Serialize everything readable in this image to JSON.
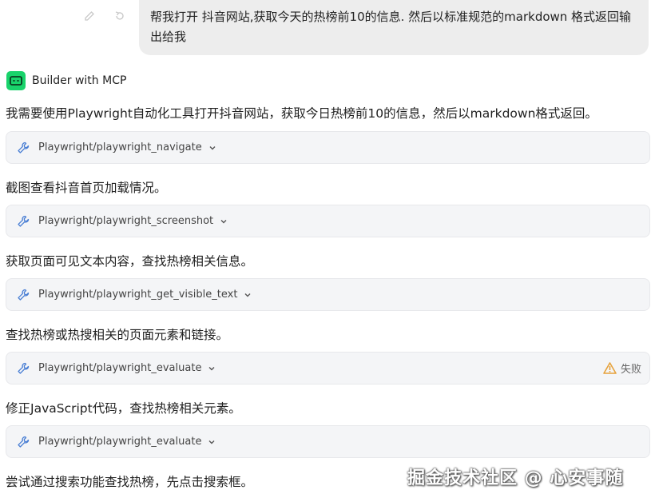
{
  "user_message": {
    "text": "帮我打开 抖音网站,获取今天的热榜前10的信息. 然后以标准规范的markdown 格式返回输出给我",
    "actions": [
      {
        "icon": "edit-icon"
      },
      {
        "icon": "retry-icon"
      }
    ]
  },
  "assistant": {
    "name": "Builder with MCP",
    "avatar_icon": "robot-icon",
    "avatar_color": "#19d36b"
  },
  "steps": [
    {
      "text": "我需要使用Playwright自动化工具打开抖音网站，获取今日热榜前10的信息，然后以markdown格式返回。",
      "tool": "Playwright/playwright_navigate"
    },
    {
      "text": "截图查看抖音首页加载情况。",
      "tool": "Playwright/playwright_screenshot"
    },
    {
      "text": "获取页面可见文本内容，查找热榜相关信息。",
      "tool": "Playwright/playwright_get_visible_text"
    },
    {
      "text": "查找热榜或热搜相关的页面元素和链接。",
      "tool": "Playwright/playwright_evaluate",
      "status": "失败",
      "status_icon": "warning-icon",
      "status_color": "#e6a23c"
    },
    {
      "text": "修正JavaScript代码，查找热榜相关元素。",
      "tool": "Playwright/playwright_evaluate"
    },
    {
      "text": "尝试通过搜索功能查找热榜，先点击搜索框。"
    }
  ],
  "watermark": "掘金技术社区 @ 心安事随"
}
